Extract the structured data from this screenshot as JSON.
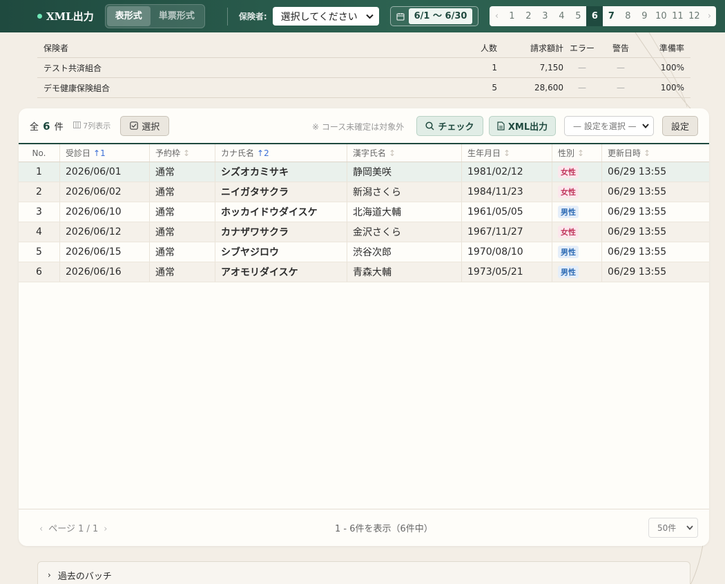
{
  "header": {
    "app_title": "XML出力",
    "view_tabs": [
      "表形式",
      "単票形式"
    ],
    "active_view": 0,
    "insurer_label": "保険者:",
    "insurer_select": "選択してください",
    "date_range": "6/1 〜 6/30",
    "months": [
      "1",
      "2",
      "3",
      "4",
      "5",
      "6",
      "7",
      "8",
      "9",
      "10",
      "11",
      "12"
    ],
    "active_month": "6"
  },
  "summary": {
    "headers": [
      "保険者",
      "人数",
      "請求額計",
      "エラー",
      "警告",
      "準備率"
    ],
    "rows": [
      [
        "テスト共済組合",
        "1",
        "7,150",
        "—",
        "—",
        "100%"
      ],
      [
        "デモ健康保険組合",
        "5",
        "28,600",
        "—",
        "—",
        "100%"
      ]
    ]
  },
  "toolbar": {
    "total_prefix": "全",
    "total_count": "6",
    "total_suffix": "件",
    "columns_note": "7列表示",
    "select_label": "選択",
    "exclusion_note": "※ コース未確定は対象外",
    "check_label": "チェック",
    "xml_label": "XML出力",
    "config_select": "— 設定を選択 —",
    "config_label": "設定"
  },
  "table": {
    "headers": [
      "No.",
      "受診日",
      "予約枠",
      "カナ氏名",
      "漢字氏名",
      "生年月日",
      "性別",
      "更新日時"
    ],
    "sort_indicators": [
      "",
      "↑1",
      "↕",
      "↑2",
      "↕",
      "↕",
      "↕",
      "↕"
    ],
    "rows": [
      [
        "1",
        "2026/06/01",
        "通常",
        "シズオカミサキ",
        "静岡美咲",
        "1981/02/12",
        "女性",
        "06/29 13:55"
      ],
      [
        "2",
        "2026/06/02",
        "通常",
        "ニイガタサクラ",
        "新潟さくら",
        "1984/11/23",
        "女性",
        "06/29 13:55"
      ],
      [
        "3",
        "2026/06/10",
        "通常",
        "ホッカイドウダイスケ",
        "北海道大輔",
        "1961/05/05",
        "男性",
        "06/29 13:55"
      ],
      [
        "4",
        "2026/06/12",
        "通常",
        "カナザワサクラ",
        "金沢さくら",
        "1967/11/27",
        "女性",
        "06/29 13:55"
      ],
      [
        "5",
        "2026/06/15",
        "通常",
        "シブヤジロウ",
        "渋谷次郎",
        "1970/08/10",
        "男性",
        "06/29 13:55"
      ],
      [
        "6",
        "2026/06/16",
        "通常",
        "アオモリダイスケ",
        "青森大輔",
        "1973/05/21",
        "男性",
        "06/29 13:55"
      ]
    ]
  },
  "pager": {
    "page_text": "ページ 1 / 1",
    "range_text": "1 - 6件を表示（6件中）",
    "per_page": "50件"
  },
  "past_batches": {
    "label": "過去のバッチ"
  },
  "colors": {
    "header_bg": "#1f4a3f",
    "accent": "#1f4a3f",
    "female": "#c1375d",
    "male": "#2e6cb5",
    "sort_active": "#3b6fd6"
  }
}
